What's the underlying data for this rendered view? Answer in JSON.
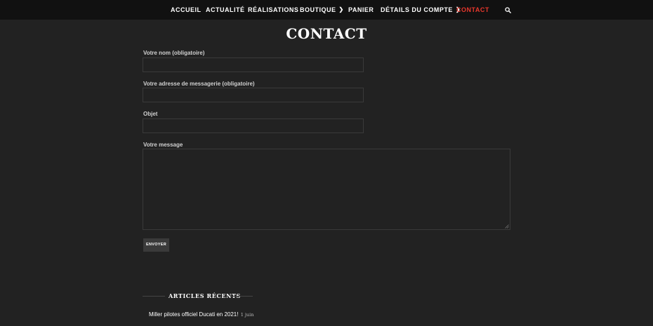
{
  "nav": {
    "items": [
      {
        "label": "ACCUEIL"
      },
      {
        "label": "ACTUALITÉ"
      },
      {
        "label": "RÉALISATIONS"
      },
      {
        "label": "BOUTIQUE"
      },
      {
        "label": "PANIER"
      },
      {
        "label": "DÉTAILS DU COMPTE"
      },
      {
        "label": "CONTACT"
      }
    ],
    "active_color": "#e8372c",
    "search_icon": "search-icon"
  },
  "page": {
    "title": "CONTACT"
  },
  "form": {
    "name_label": "Votre nom (obligatoire)",
    "name_value": "",
    "email_label": "Votre adresse de messagerie (obligatoire)",
    "email_value": "",
    "subject_label": "Objet",
    "subject_value": "",
    "message_label": "Votre message",
    "message_value": "",
    "submit_label": "ENVOYER"
  },
  "widget": {
    "title": "ARTICLES RÉCENTS",
    "articles": [
      {
        "title": "Miller pilotes officiel Ducati en 2021!",
        "date": "1 juin"
      }
    ]
  }
}
